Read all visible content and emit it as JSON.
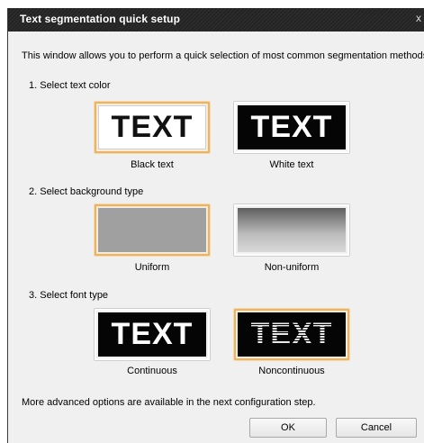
{
  "window": {
    "title": "Text segmentation quick setup",
    "close_glyph": "x"
  },
  "intro": "This window allows you to perform a quick selection of most common segmentation methods.",
  "sections": [
    {
      "heading": "1. Select text color",
      "options": [
        {
          "label": "Black text",
          "sample": "TEXT",
          "selected": true
        },
        {
          "label": "White text",
          "sample": "TEXT",
          "selected": false
        }
      ]
    },
    {
      "heading": "2. Select background type",
      "options": [
        {
          "label": "Uniform",
          "sample": "",
          "selected": true
        },
        {
          "label": "Non-uniform",
          "sample": "",
          "selected": false
        }
      ]
    },
    {
      "heading": "3. Select font type",
      "options": [
        {
          "label": "Continuous",
          "sample": "TEXT",
          "selected": false
        },
        {
          "label": "Noncontinuous",
          "sample": "TEXT",
          "selected": true
        }
      ]
    }
  ],
  "footer_note": "More advanced options are available in the next configuration step.",
  "buttons": {
    "ok": "OK",
    "cancel": "Cancel"
  },
  "colors": {
    "selection_border": "#e8b46b",
    "titlebar": "#242424"
  }
}
